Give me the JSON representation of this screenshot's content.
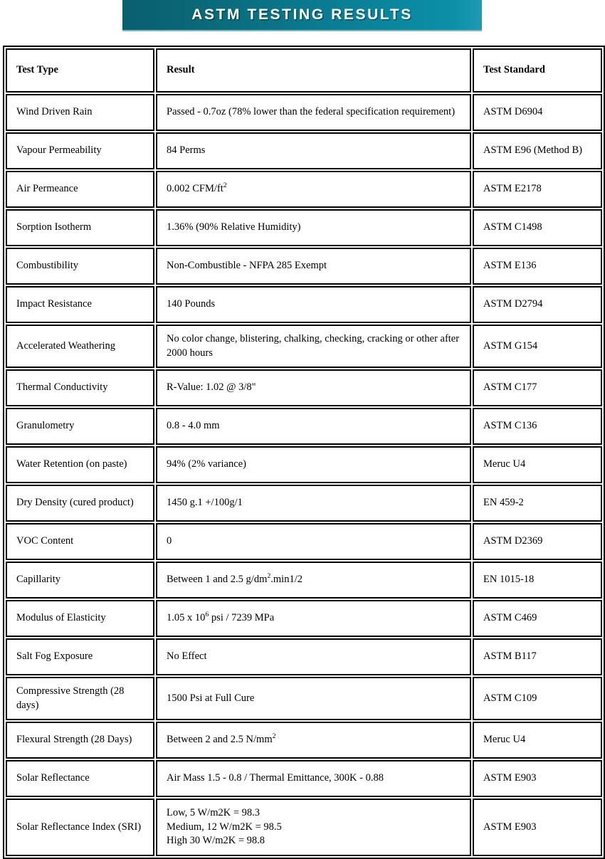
{
  "banner": {
    "title": "ASTM TESTING RESULTS",
    "gradient_from": "#0a5f6d",
    "gradient_to": "#0b90a8",
    "text_color": "#ffffff",
    "underline_color": "#7fb6c4"
  },
  "table": {
    "headers": {
      "test_type": "Test Type",
      "result": "Result",
      "test_standard": "Test Standard"
    },
    "rows": [
      {
        "test_type": "Wind Driven Rain",
        "result": "Passed - 0.7oz (78% lower than the federal specification requirement)",
        "test_standard": "ASTM D6904"
      },
      {
        "test_type": "Vapour Permeability",
        "result": "84 Perms",
        "test_standard": "ASTM E96 (Method B)"
      },
      {
        "test_type": "Air Permeance",
        "result_prefix": "0.002 CFM/ft",
        "result_sup": "2",
        "result": "0.002 CFM/ft2",
        "test_standard": "ASTM E2178"
      },
      {
        "test_type": "Sorption Isotherm",
        "result": "1.36% (90% Relative Humidity)",
        "test_standard": "ASTM C1498"
      },
      {
        "test_type": "Combustibility",
        "result": "Non-Combustible - NFPA 285 Exempt",
        "test_standard": "ASTM E136"
      },
      {
        "test_type": "Impact Resistance",
        "result": "140 Pounds",
        "test_standard": "ASTM D2794"
      },
      {
        "test_type": "Accelerated Weathering",
        "result": "No color change, blistering, chalking, checking, cracking or other after 2000 hours",
        "test_standard": "ASTM G154"
      },
      {
        "test_type": "Thermal Conductivity",
        "result": "R-Value:  1.02 @ 3/8\"",
        "test_standard": "ASTM C177"
      },
      {
        "test_type": "Granulometry",
        "result": "0.8 - 4.0 mm",
        "test_standard": "ASTM C136"
      },
      {
        "test_type": "Water Retention (on paste)",
        "result": "94% (2% variance)",
        "test_standard": "Meruc U4"
      },
      {
        "test_type": "Dry Density (cured product)",
        "result": "1450 g.1 +/100g/1",
        "test_standard": "EN 459-2"
      },
      {
        "test_type": "VOC Content",
        "result": "0",
        "test_standard": "ASTM D2369"
      },
      {
        "test_type": "Capillarity",
        "result_prefix": "Between 1 and 2.5 g/dm",
        "result_sup": "2",
        "result_suffix": ".min1/2",
        "result": "Between 1 and 2.5 g/dm2.min1/2",
        "test_standard": "EN 1015-18"
      },
      {
        "test_type": "Modulus of Elasticity",
        "result_prefix": "1.05 x 10",
        "result_sup": "6",
        "result_suffix": " psi    /    7239 MPa",
        "result": "1.05 x 106 psi / 7239 MPa",
        "test_standard": "ASTM C469"
      },
      {
        "test_type": "Salt Fog Exposure",
        "result": "No Effect",
        "test_standard": "ASTM B117"
      },
      {
        "test_type": "Compressive Strength (28 days)",
        "result": "1500 Psi at Full Cure",
        "test_standard": "ASTM C109"
      },
      {
        "test_type": "Flexural Strength (28 Days)",
        "result_prefix": "Between 2 and 2.5 N/mm",
        "result_sup": "2",
        "result": "Between 2 and 2.5 N/mm2",
        "test_standard": "Meruc U4"
      },
      {
        "test_type": "Solar Reflectance",
        "result": "Air Mass 1.5 - 0.8 / Thermal Emittance, 300K - 0.88",
        "test_standard": "ASTM E903"
      },
      {
        "test_type": "Solar Reflectance Index (SRI)",
        "result": "Low, 5 W/m2K = 98.3\nMedium, 12 W/m2K = 98.5\nHigh 30 W/m2K = 98.8",
        "test_standard": "ASTM E903"
      }
    ]
  }
}
